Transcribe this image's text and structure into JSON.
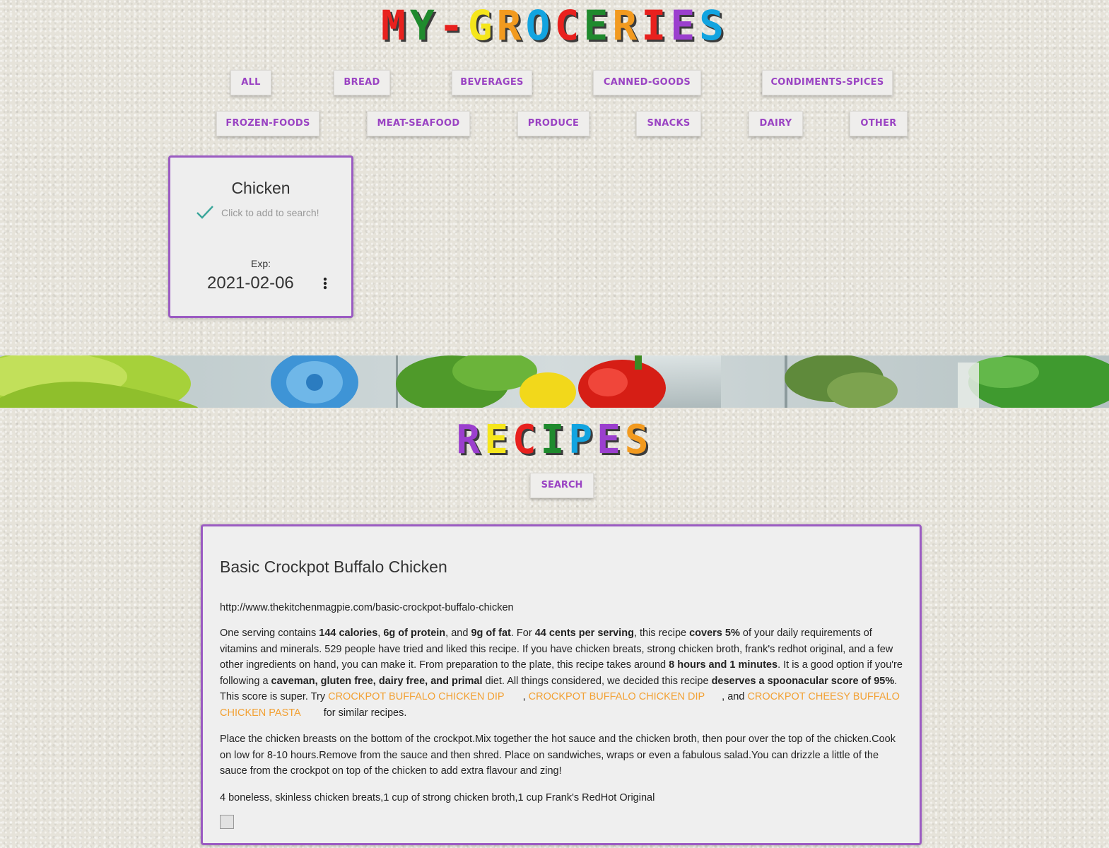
{
  "header": {
    "title_letters": [
      {
        "ch": "M",
        "color": "#e8211e"
      },
      {
        "ch": "Y",
        "color": "#1f8a2d"
      },
      {
        "ch": "-",
        "color": "#e8211e"
      },
      {
        "ch": "G",
        "color": "#f5e61c"
      },
      {
        "ch": "R",
        "color": "#f29a1f"
      },
      {
        "ch": "O",
        "color": "#12a4e0"
      },
      {
        "ch": "C",
        "color": "#e8211e"
      },
      {
        "ch": "E",
        "color": "#1f8a2d"
      },
      {
        "ch": "R",
        "color": "#f29a1f"
      },
      {
        "ch": "I",
        "color": "#e8211e"
      },
      {
        "ch": "E",
        "color": "#9b3fce"
      },
      {
        "ch": "S",
        "color": "#12a4e0"
      }
    ]
  },
  "categories": {
    "row1": [
      "ALL",
      "BREAD",
      "BEVERAGES",
      "CANNED-GOODS",
      "CONDIMENTS-SPICES"
    ],
    "row2": [
      "FROZEN-FOODS",
      "MEAT-SEAFOOD",
      "PRODUCE",
      "SNACKS",
      "DAIRY",
      "OTHER"
    ]
  },
  "grocery_item": {
    "name": "Chicken",
    "add_hint": "Click to add to search!",
    "exp_label": "Exp:",
    "exp_date": "2021-02-06",
    "icons": {
      "check": "check-icon",
      "menu": "more-vert-icon"
    }
  },
  "recipes_section": {
    "title_letters": [
      {
        "ch": "R",
        "color": "#9b3fce"
      },
      {
        "ch": "E",
        "color": "#f5e61c"
      },
      {
        "ch": "C",
        "color": "#e8211e"
      },
      {
        "ch": "I",
        "color": "#1f8a2d"
      },
      {
        "ch": "P",
        "color": "#12a4e0"
      },
      {
        "ch": "E",
        "color": "#9b3fce"
      },
      {
        "ch": "S",
        "color": "#f29a1f"
      }
    ],
    "search_label": "SEARCH"
  },
  "recipe": {
    "title": "Basic Crockpot Buffalo Chicken",
    "url": "http://www.thekitchenmagpie.com/basic-crockpot-buffalo-chicken",
    "summary": {
      "t1": "One serving contains ",
      "b1": "144 calories",
      "t2": ", ",
      "b2": "6g of protein",
      "t3": ", and ",
      "b3": "9g of fat",
      "t4": ". For ",
      "b4": "44 cents per serving",
      "t5": ", this recipe ",
      "b5": "covers 5%",
      "t6": " of your daily requirements of vitamins and minerals. 529 people have tried and liked this recipe. If you have chicken breats, strong chicken broth, frank's redhot original, and a few other ingredients on hand, you can make it. From preparation to the plate, this recipe takes around ",
      "b6": "8 hours and 1 minutes",
      "t7": ". It is a good option if you're following a ",
      "b7": "caveman, gluten free, dairy free, and primal",
      "t8": " diet. All things considered, we decided this recipe ",
      "b8": "deserves a spoonacular score of 95%",
      "t9": ". This score is super. Try ",
      "link1": "CROCKPOT BUFFALO CHICKEN DIP",
      "t10": ", ",
      "link2": "CROCKPOT BUFFALO CHICKEN DIP",
      "t11": ", and ",
      "link3": "CROCKPOT CHEESY BUFFALO CHICKEN PASTA",
      "t12": " for similar recipes."
    },
    "instructions": "Place the chicken breasts on the bottom of the crockpot.Mix together the hot sauce and the chicken broth, then pour over the top of the chicken.Cook on low for 8-10 hours.Remove from the sauce and then shred. Place on sandwiches, wraps or even a fabulous salad.You can drizzle a little of the sauce from the crockpot on top of the chicken to add extra flavour and zing!",
    "ingredients": "4 boneless, skinless chicken breats,1 cup of strong chicken broth,1 cup Frank's RedHot Original"
  },
  "colors": {
    "accent_purple": "#9a43c3",
    "card_border": "#9b5bc2",
    "link_orange": "#f2a134",
    "check_teal": "#3aa69a"
  }
}
